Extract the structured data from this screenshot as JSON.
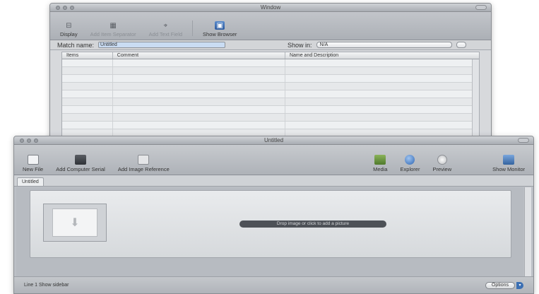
{
  "back_window": {
    "title": "Window",
    "toolbar": [
      {
        "label": "Display",
        "icon": "sliders-icon",
        "dim": false
      },
      {
        "label": "Add Item Separator",
        "icon": "grid-icon",
        "dim": true
      },
      {
        "label": "Add Text Field",
        "icon": "cursor-icon",
        "dim": true
      },
      {
        "label": "Show Browser",
        "icon": "browser-icon",
        "dim": false
      }
    ],
    "search": {
      "label": "Match name:",
      "value": "Untitled",
      "show_label": "Show in:",
      "show_value": "N/A"
    },
    "table": {
      "headers": [
        "Items",
        "Comment",
        "Name and Description"
      ],
      "row_count": 10
    }
  },
  "front_window": {
    "title": "Untitled",
    "toolbar_left": [
      {
        "label": "New File",
        "icon": "document-icon"
      },
      {
        "label": "Add Computer Serial",
        "icon": "computer-icon"
      },
      {
        "label": "Add Image Reference",
        "icon": "image-icon"
      }
    ],
    "toolbar_right": [
      {
        "label": "Media",
        "icon": "media-icon"
      },
      {
        "label": "Explorer",
        "icon": "globe-icon"
      },
      {
        "label": "Preview",
        "icon": "play-icon"
      },
      {
        "label": "Show Monitor",
        "icon": "monitor-icon"
      }
    ],
    "tab": "Untitled",
    "drop_hint": "Drop image or click to add a picture",
    "status": {
      "text": "Line 1  Show sidebar",
      "button": "Options"
    }
  }
}
